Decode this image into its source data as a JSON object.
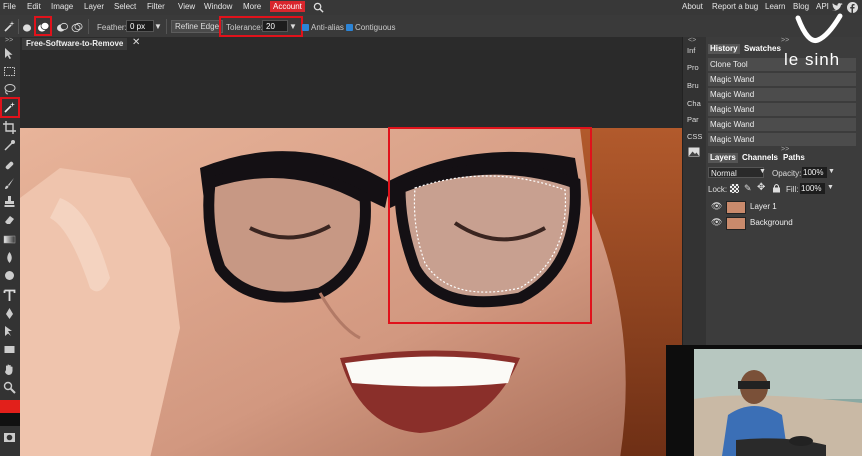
{
  "menubar": {
    "items": [
      "File",
      "Edit",
      "Image",
      "Layer",
      "Select",
      "Filter",
      "View",
      "Window",
      "More",
      "Account"
    ],
    "right_links": [
      "About",
      "Report a bug",
      "Learn",
      "Blog",
      "API"
    ]
  },
  "options": {
    "feather_label": "Feather:",
    "feather_value": "0 px",
    "refine_edge": "Refine Edge",
    "tolerance_label": "Tolerance:",
    "tolerance_value": "20",
    "antialias_label": "Anti-alias",
    "contiguous_label": "Contiguous"
  },
  "document": {
    "tab_title": "Free-Software-to-Remove",
    "close_glyph": "✕"
  },
  "mini_column": [
    "Inf",
    "Pro",
    "Bru",
    "Cha",
    "Par",
    "CSS"
  ],
  "history_panel": {
    "tabs": [
      "History",
      "Swatches"
    ],
    "entries": [
      "Clone Tool",
      "Magic Wand",
      "Magic Wand",
      "Magic Wand",
      "Magic Wand",
      "Magic Wand"
    ]
  },
  "layers_panel": {
    "tabs": [
      "Layers",
      "Channels",
      "Paths"
    ],
    "blend_mode": "Normal",
    "opacity_label": "Opacity:",
    "opacity_value": "100%",
    "lock_label": "Lock:",
    "fill_label": "Fill:",
    "fill_value": "100%",
    "layers": [
      "Layer 1",
      "Background"
    ]
  },
  "logo": {
    "text": "le sinh"
  },
  "colors": {
    "accent": "#d8262d",
    "highlight": "#e0121b"
  }
}
